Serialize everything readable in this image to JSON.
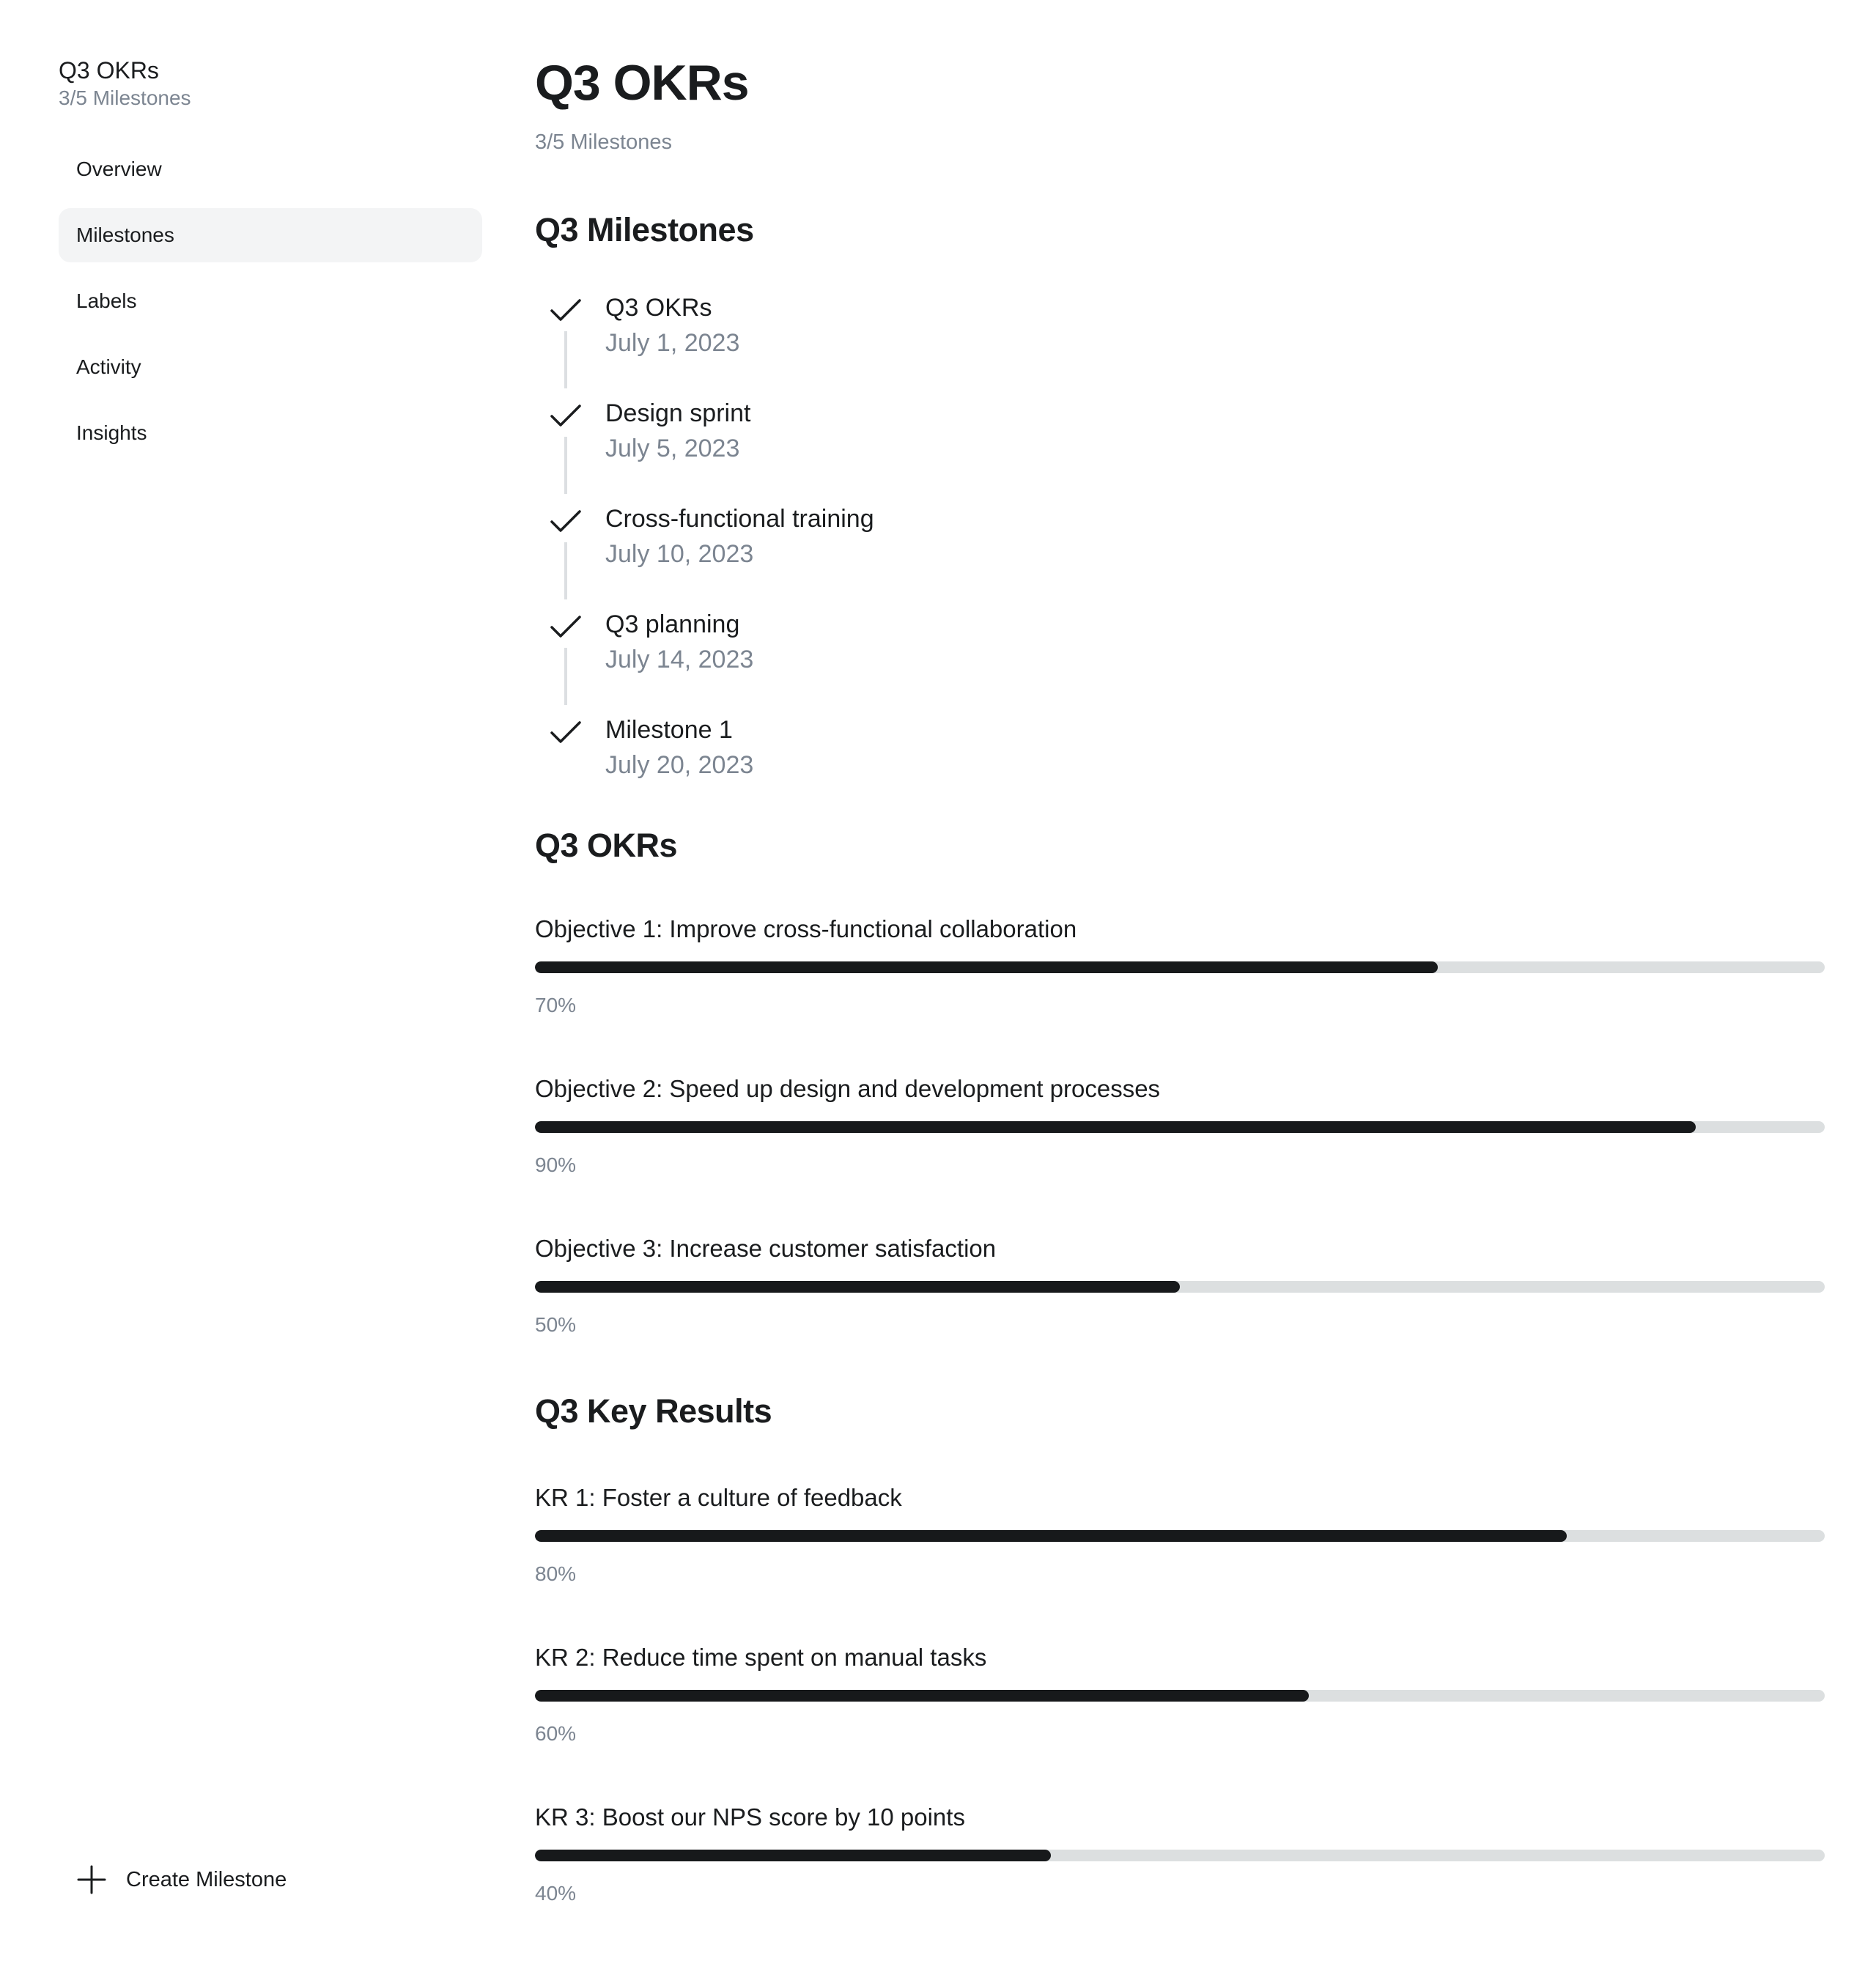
{
  "sidebar": {
    "title": "Q3 OKRs",
    "subtitle": "3/5 Milestones",
    "items": [
      {
        "label": "Overview",
        "active": false
      },
      {
        "label": "Milestones",
        "active": true
      },
      {
        "label": "Labels",
        "active": false
      },
      {
        "label": "Activity",
        "active": false
      },
      {
        "label": "Insights",
        "active": false
      }
    ],
    "create_label": "Create Milestone"
  },
  "main": {
    "title": "Q3 OKRs",
    "subtitle": "3/5 Milestones",
    "milestones_heading": "Q3 Milestones",
    "milestones": [
      {
        "title": "Q3 OKRs",
        "date": "July 1, 2023"
      },
      {
        "title": "Design sprint",
        "date": "July 5, 2023"
      },
      {
        "title": "Cross-functional training",
        "date": "July 10, 2023"
      },
      {
        "title": "Q3 planning",
        "date": "July 14, 2023"
      },
      {
        "title": "Milestone 1",
        "date": "July 20, 2023"
      }
    ],
    "okrs_heading": "Q3 OKRs",
    "objectives": [
      {
        "label": "Objective 1: Improve cross-functional collaboration",
        "percent_label": "70%",
        "progress": 0.7
      },
      {
        "label": "Objective 2: Speed up design and development processes",
        "percent_label": "90%",
        "progress": 0.9
      },
      {
        "label": "Objective 3: Increase customer satisfaction",
        "percent_label": "50%",
        "progress": 0.5
      }
    ],
    "kr_heading": "Q3 Key Results",
    "key_results": [
      {
        "label": "KR 1: Foster a culture of feedback",
        "percent_label": "80%",
        "progress": 0.8
      },
      {
        "label": "KR 2: Reduce time spent on manual tasks",
        "percent_label": "60%",
        "progress": 0.6
      },
      {
        "label": "KR 3: Boost our NPS score by 10 points",
        "percent_label": "40%",
        "progress": 0.4
      }
    ]
  },
  "icons": {
    "milestone_status": "check-icon",
    "create": "plus-icon"
  },
  "colors": {
    "progress_fill": "#17191b",
    "progress_track": "#dcdfe0",
    "muted_text": "#7c8591",
    "active_nav_bg": "#f3f4f5"
  }
}
